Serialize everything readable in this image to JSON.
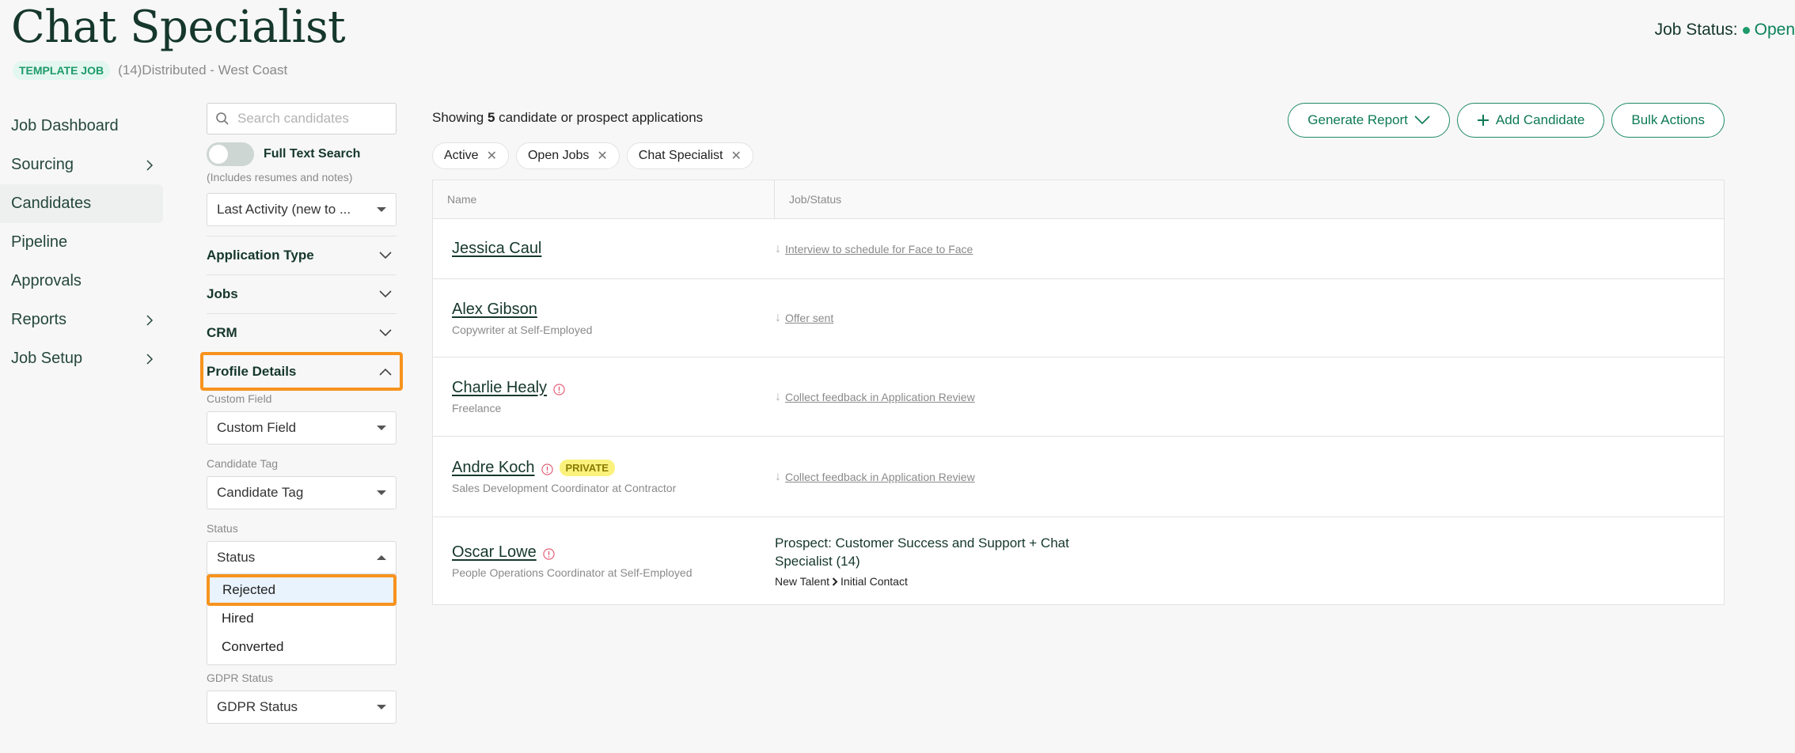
{
  "header": {
    "title": "Chat Specialist",
    "template_badge": "TEMPLATE JOB",
    "location": "(14)Distributed - West Coast",
    "job_status_label": "Job Status:",
    "job_status_value": "Open",
    "status_color": "#1e9a6b"
  },
  "nav": {
    "items": [
      {
        "label": "Job Dashboard",
        "chevron": false,
        "active": false
      },
      {
        "label": "Sourcing",
        "chevron": true,
        "active": false
      },
      {
        "label": "Candidates",
        "chevron": false,
        "active": true
      },
      {
        "label": "Pipeline",
        "chevron": false,
        "active": false
      },
      {
        "label": "Approvals",
        "chevron": false,
        "active": false
      },
      {
        "label": "Reports",
        "chevron": true,
        "active": false
      },
      {
        "label": "Job Setup",
        "chevron": true,
        "active": false
      }
    ]
  },
  "filters": {
    "search_placeholder": "Search candidates",
    "search_value": "",
    "full_text_label": "Full Text Search",
    "full_text_enabled": false,
    "full_text_hint": "(Includes resumes and notes)",
    "sort_value": "Last Activity (new to ...",
    "sections": [
      {
        "label": "Application Type",
        "expanded": false
      },
      {
        "label": "Jobs",
        "expanded": false
      },
      {
        "label": "CRM",
        "expanded": false
      },
      {
        "label": "Profile Details",
        "expanded": true
      }
    ],
    "profile_details": {
      "custom_field_label": "Custom Field",
      "custom_field_value": "Custom Field",
      "candidate_tag_label": "Candidate Tag",
      "candidate_tag_value": "Candidate Tag",
      "status_label": "Status",
      "status_value": "Status",
      "status_options": [
        "Rejected",
        "Hired",
        "Converted"
      ],
      "status_highlighted": "Rejected",
      "gdpr_label": "GDPR Status",
      "gdpr_value": "GDPR Status"
    },
    "highlight_color": "#f7931e"
  },
  "main": {
    "showing_prefix": "Showing",
    "showing_count": "5",
    "showing_suffix": "candidate or prospect applications",
    "actions": {
      "generate_report": "Generate Report",
      "add_candidate": "Add Candidate",
      "bulk_actions": "Bulk Actions"
    },
    "chips": [
      "Active",
      "Open Jobs",
      "Chat Specialist"
    ],
    "table": {
      "columns": [
        "Name",
        "Job/Status"
      ],
      "rows": [
        {
          "name": "Jessica Caul",
          "subtitle": "",
          "alert": false,
          "private": false,
          "status": "Interview to schedule for Face to Face"
        },
        {
          "name": "Alex Gibson",
          "subtitle": "Copywriter at Self-Employed",
          "alert": false,
          "private": false,
          "status": "Offer sent"
        },
        {
          "name": "Charlie Healy",
          "subtitle": "Freelance",
          "alert": true,
          "private": false,
          "status": "Collect feedback in Application Review"
        },
        {
          "name": "Andre Koch",
          "subtitle": "Sales Development Coordinator at Contractor",
          "alert": true,
          "private": true,
          "private_label": "PRIVATE",
          "status": "Collect feedback in Application Review"
        },
        {
          "name": "Oscar Lowe",
          "subtitle": "People Operations Coordinator at Self-Employed",
          "alert": true,
          "private": false,
          "prospect_title": "Prospect: Customer Success and Support + Chat Specialist (14)",
          "prospect_stage_from": "New Talent",
          "prospect_stage_to": "Initial Contact"
        }
      ]
    }
  }
}
